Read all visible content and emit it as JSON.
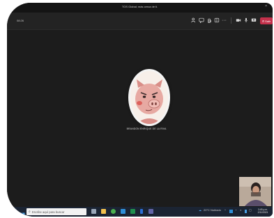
{
  "window": {
    "title": "TOS Global; más cerca de ti.",
    "close_glyph": "×"
  },
  "toolbar": {
    "timer": "08:26",
    "tools": [
      {
        "icon": "people-icon"
      },
      {
        "icon": "chat-icon"
      },
      {
        "icon": "raise-hand-icon"
      },
      {
        "icon": "rooms-icon"
      },
      {
        "icon": "more-options-icon"
      },
      {
        "icon": "camera-icon"
      },
      {
        "icon": "mic-icon"
      },
      {
        "icon": "share-screen-icon"
      }
    ],
    "more_glyph": "···",
    "leave_label": "Salir",
    "leave_color": "#c4314b"
  },
  "meeting": {
    "participant_name": "BRANDON ENRIQUE DE LA RIVA",
    "avatar_icon": "pig-avatar-icon"
  },
  "taskbar": {
    "search_placeholder": "Escribe aquí para buscar",
    "apps": [
      {
        "icon": "task-view-icon",
        "color": "#9aa7b8"
      },
      {
        "icon": "file-explorer-icon",
        "color": "#f2c14e"
      },
      {
        "icon": "chrome-icon",
        "color": "#4caf50"
      },
      {
        "icon": "edge-icon",
        "color": "#2f8fd8"
      },
      {
        "icon": "excel-icon",
        "color": "#1f8f4e"
      },
      {
        "icon": "pin-icon",
        "color": "#2d6fd6"
      },
      {
        "icon": "teams-icon",
        "color": "#6264a7"
      }
    ],
    "weather": "20°C Nublado",
    "tray_glyph": "^",
    "time": "3:49 p.m.",
    "date": "2/11/2021"
  }
}
